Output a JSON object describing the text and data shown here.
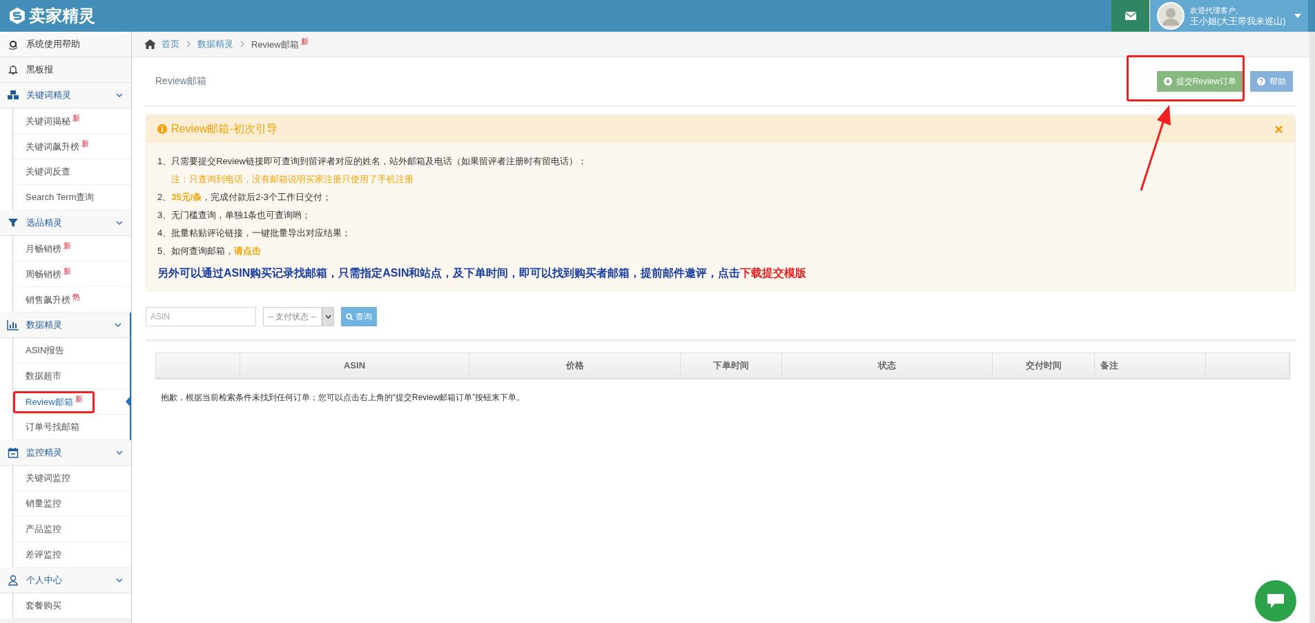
{
  "header": {
    "logo": "卖家精灵",
    "greeting": "欢迎代理客户,",
    "user": "王小姐(大王带我来巡山)"
  },
  "sidebar": {
    "items": [
      {
        "label": "系统使用帮助"
      },
      {
        "label": "黑板报"
      },
      {
        "label": "关键词精灵",
        "expanded": true,
        "active": false,
        "children": [
          {
            "label": "关键词揭秘",
            "badge": "新",
            "selected": false
          },
          {
            "label": "关键词飙升榜",
            "badge": "新",
            "selected": false
          },
          {
            "label": "关键词反查",
            "selected": false
          },
          {
            "label": "Search Term查询",
            "selected": false
          }
        ]
      },
      {
        "label": "选品精灵",
        "expanded": true,
        "active": false,
        "children": [
          {
            "label": "月畅销榜",
            "badge": "新",
            "selected": false
          },
          {
            "label": "周畅销榜",
            "badge": "新",
            "selected": false
          },
          {
            "label": "销售飙升榜",
            "badge": "热",
            "selected": false
          }
        ]
      },
      {
        "label": "数据精灵",
        "expanded": true,
        "active": true,
        "children": [
          {
            "label": "ASIN报告",
            "selected": false
          },
          {
            "label": "数据超市",
            "selected": false
          },
          {
            "label": "Review邮箱",
            "badge": "新",
            "selected": true
          },
          {
            "label": "订单号找邮箱",
            "selected": false
          }
        ]
      },
      {
        "label": "监控精灵",
        "expanded": true,
        "active": false,
        "children": [
          {
            "label": "关键词监控",
            "selected": false
          },
          {
            "label": "销量监控",
            "selected": false
          },
          {
            "label": "产品监控",
            "selected": false
          },
          {
            "label": "差评监控",
            "selected": false
          }
        ]
      },
      {
        "label": "个人中心",
        "expanded": true,
        "active": false,
        "children": [
          {
            "label": "套餐购买",
            "selected": false
          }
        ]
      }
    ]
  },
  "breadcrumb": [
    {
      "label": "首页",
      "kind": "link"
    },
    {
      "label": "数据精灵",
      "kind": "link"
    },
    {
      "label": "Review邮箱",
      "kind": "current",
      "badge": "新"
    }
  ],
  "page_title": "Review邮箱",
  "buttons": [
    {
      "label": "提交Review订单",
      "kind": "submit"
    },
    {
      "label": "帮助",
      "kind": "help"
    }
  ],
  "notice": {
    "title": "Review邮箱-初次引导",
    "lines": [
      {
        "kind": "plain",
        "segments": [
          {
            "text": "1、只需要提交Review链接即可查询到留评者对应的姓名，站外邮箱及电话（如果留评者注册时有留电话）；",
            "kind": "plain"
          }
        ]
      },
      {
        "kind": "note",
        "segments": [
          {
            "text": "注：只查询到电话，没有邮箱说明买家注册只使用了手机注册",
            "kind": "plain"
          }
        ]
      },
      {
        "kind": "plain",
        "segments": [
          {
            "text": "2、",
            "kind": "plain"
          },
          {
            "text": "35元/条",
            "kind": "highlight"
          },
          {
            "text": "，完成付款后2-3个工作日交付；",
            "kind": "plain"
          }
        ]
      },
      {
        "kind": "plain",
        "segments": [
          {
            "text": "3、无门槛查询，单独1条也可查询哟；",
            "kind": "plain"
          }
        ]
      },
      {
        "kind": "plain",
        "segments": [
          {
            "text": "4、批量粘贴评论链接，一键批量导出对应结果；",
            "kind": "plain"
          }
        ]
      },
      {
        "kind": "plain",
        "segments": [
          {
            "text": "5、如何查询邮箱，",
            "kind": "plain"
          },
          {
            "text": "请点击",
            "kind": "link"
          }
        ]
      },
      {
        "kind": "emphasis",
        "segments": [
          {
            "text": "另外可以通过ASIN购买记录找邮箱，只需指定ASIN和站点，及下单时间，即可以找到购买者邮箱，提前邮件邀评，点击",
            "kind": "plain"
          },
          {
            "text": "下载提交模版",
            "kind": "redlink"
          }
        ]
      }
    ]
  },
  "filters": {
    "asin_placeholder": "ASIN",
    "status": "-- 支付状态 --",
    "search": "查询"
  },
  "table": {
    "columns": [
      {},
      {
        "label": "ASIN"
      },
      {
        "label": "价格"
      },
      {
        "label": "下单时间"
      },
      {
        "label": "状态"
      },
      {
        "label": "交付时间"
      },
      {
        "label": "备注"
      },
      {}
    ],
    "empty_message": "抱歉，根据当前检索条件未找到任何订单；您可以点击右上角的“提交Review邮箱订单”按钮来下单。"
  }
}
